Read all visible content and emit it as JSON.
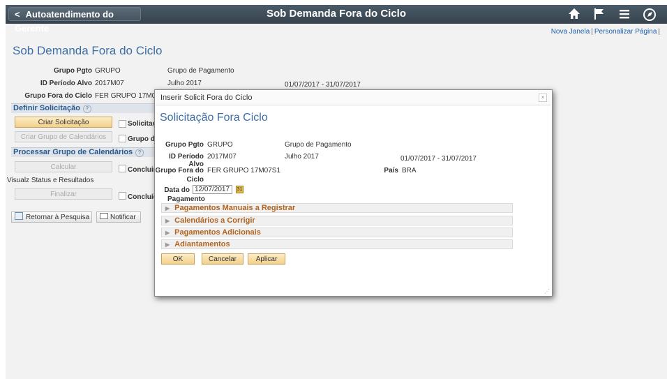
{
  "header": {
    "back_label": "Autoatendimento do Gerente",
    "title": "Sob Demanda Fora do Ciclo",
    "icons": [
      "home-icon",
      "flag-icon",
      "menu-icon",
      "navbar-icon"
    ]
  },
  "links": {
    "new_window": "Nova Janela",
    "sep": "|",
    "personalize": "Personalizar Página",
    "trailing_sep": "|"
  },
  "page": {
    "title": "Sob Demanda Fora do Ciclo",
    "grupo_pgto_label": "Grupo Pgto",
    "grupo_pgto_value": "GRUPO",
    "grupo_pgto_desc": "Grupo de Pagamento",
    "periodo_label": "ID Período Alvo",
    "periodo_value": "2017M07",
    "periodo_desc": "Julho 2017",
    "periodo_dates": "01/07/2017  -  31/07/2017",
    "fora_ciclo_label": "Grupo Fora do Ciclo",
    "fora_ciclo_value": "FER GRUPO 17M07"
  },
  "definir": {
    "title": "Definir Solicitação",
    "criar_solicitacao": "Criar Solicitação",
    "solicitacao_check_label": "Solicitaç",
    "criar_grupo": "Criar Grupo de Calendários",
    "grupo_check_label": "Grupo de"
  },
  "processar": {
    "title": "Processar Grupo de Calendários",
    "calcular": "Calcular",
    "concluir_label": "Concluir",
    "visualz": "Visualz Status e Resultados",
    "finalizar": "Finalizar",
    "concluido_label": "Concluíd"
  },
  "bottom": {
    "retornar": "Retornar à Pesquisa",
    "notificar": "Notificar"
  },
  "modal": {
    "header": "Inserir Solicit Fora do Ciclo",
    "close": "×",
    "title": "Solicitação Fora Ciclo",
    "grupo_pgto_label": "Grupo Pgto",
    "grupo_pgto_value": "GRUPO",
    "grupo_pgto_desc": "Grupo de Pagamento",
    "periodo_label": "ID Período Alvo",
    "periodo_value": "2017M07",
    "periodo_desc": "Julho 2017",
    "periodo_dates": "01/07/2017  -  31/07/2017",
    "fora_label_1": "Grupo Fora do",
    "fora_label_2": "Ciclo",
    "fora_value": "FER GRUPO 17M07S1",
    "pais_label": "País",
    "pais_value": "BRA",
    "data_label_1": "Data do",
    "data_label_2": "Pagamento",
    "data_value": "12/07/2017",
    "groups": [
      "Pagamentos Manuais a Registrar",
      "Calendários a Corrigir",
      "Pagamentos Adicionais",
      "Adiantamentos"
    ],
    "ok": "OK",
    "cancel": "Cancelar",
    "apply": "Aplicar"
  }
}
